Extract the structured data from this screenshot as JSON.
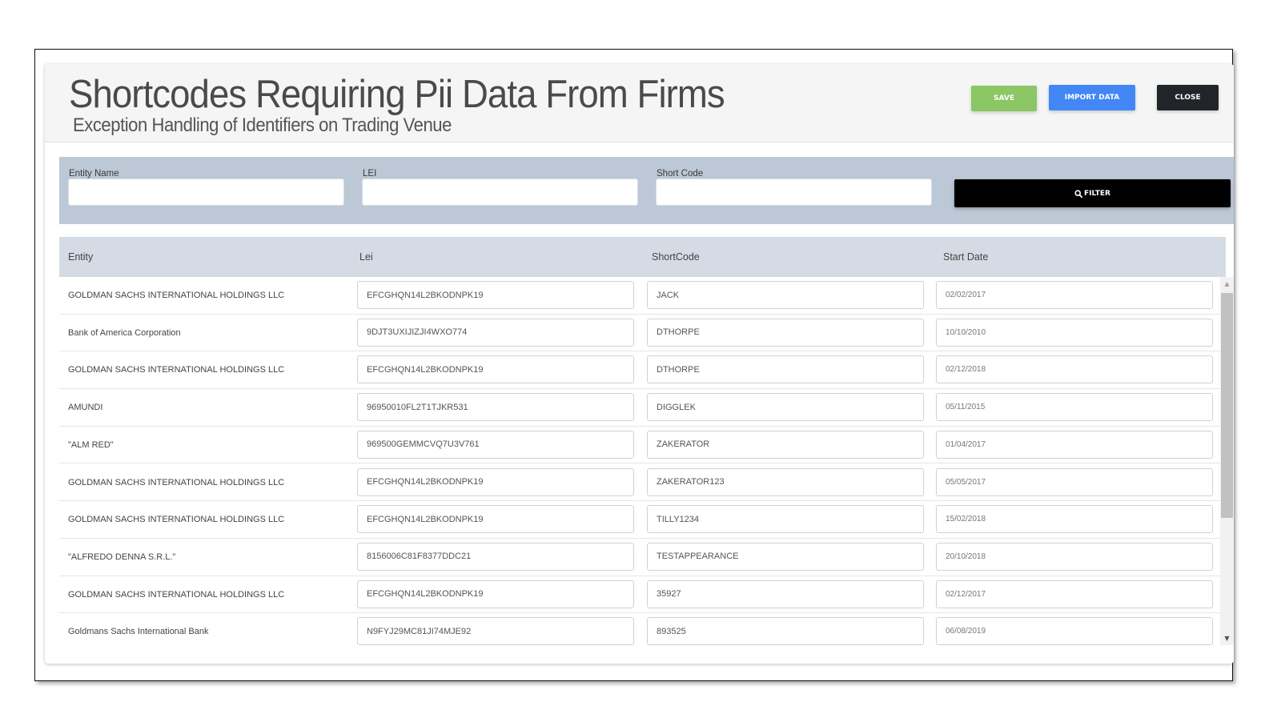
{
  "header": {
    "title": "Shortcodes Requiring Pii Data From Firms",
    "subtitle": "Exception Handling of Identifiers on Trading Venue"
  },
  "actions": {
    "save_label": "SAVE",
    "import_label": "IMPORT DATA",
    "close_label": "CLOSE"
  },
  "colors": {
    "save": "#8bc765",
    "import": "#4287f5",
    "close": "#212428",
    "filter_bar": "#bcc8d6",
    "table_header": "#d5dbe4"
  },
  "filters": {
    "entity_name": {
      "label": "Entity Name",
      "value": ""
    },
    "lei": {
      "label": "LEI",
      "value": ""
    },
    "short_code": {
      "label": "Short Code",
      "value": ""
    },
    "filter_label": "FILTER",
    "filter_icon": "search-icon"
  },
  "table": {
    "columns": [
      "Entity",
      "Lei",
      "ShortCode",
      "Start Date"
    ],
    "rows": [
      {
        "entity": "GOLDMAN SACHS INTERNATIONAL HOLDINGS LLC",
        "lei": "EFCGHQN14L2BKODNPK19",
        "shortcode": "JACK",
        "start_date": "02/02/2017"
      },
      {
        "entity": "Bank of America Corporation",
        "lei": "9DJT3UXIJIZJI4WXO774",
        "shortcode": "DTHORPE",
        "start_date": "10/10/2010"
      },
      {
        "entity": "GOLDMAN SACHS INTERNATIONAL HOLDINGS LLC",
        "lei": "EFCGHQN14L2BKODNPK19",
        "shortcode": "DTHORPE",
        "start_date": "02/12/2018"
      },
      {
        "entity": "AMUNDI",
        "lei": "96950010FL2T1TJKR531",
        "shortcode": "DIGGLEK",
        "start_date": "05/11/2015"
      },
      {
        "entity": "\"ALM RED\"",
        "lei": "969500GEMMCVQ7U3V761",
        "shortcode": "ZAKERATOR",
        "start_date": "01/04/2017"
      },
      {
        "entity": "GOLDMAN SACHS INTERNATIONAL HOLDINGS LLC",
        "lei": "EFCGHQN14L2BKODNPK19",
        "shortcode": "ZAKERATOR123",
        "start_date": "05/05/2017"
      },
      {
        "entity": "GOLDMAN SACHS INTERNATIONAL HOLDINGS LLC",
        "lei": "EFCGHQN14L2BKODNPK19",
        "shortcode": "TILLY1234",
        "start_date": "15/02/2018"
      },
      {
        "entity": "\"ALFREDO DENNA S.R.L.\"",
        "lei": "8156006C81F8377DDC21",
        "shortcode": "TESTAPPEARANCE",
        "start_date": "20/10/2018"
      },
      {
        "entity": "GOLDMAN SACHS INTERNATIONAL HOLDINGS LLC",
        "lei": "EFCGHQN14L2BKODNPK19",
        "shortcode": "35927",
        "start_date": "02/12/2017"
      },
      {
        "entity": "Goldmans Sachs International Bank",
        "lei": "N9FYJ29MC81JI74MJE92",
        "shortcode": "893525",
        "start_date": "06/08/2019"
      }
    ]
  },
  "scrollbar": {
    "up_icon": "scroll-up-arrow-icon",
    "down_icon": "scroll-down-arrow-icon",
    "visible_fraction": 0.61,
    "position": 0.0
  }
}
